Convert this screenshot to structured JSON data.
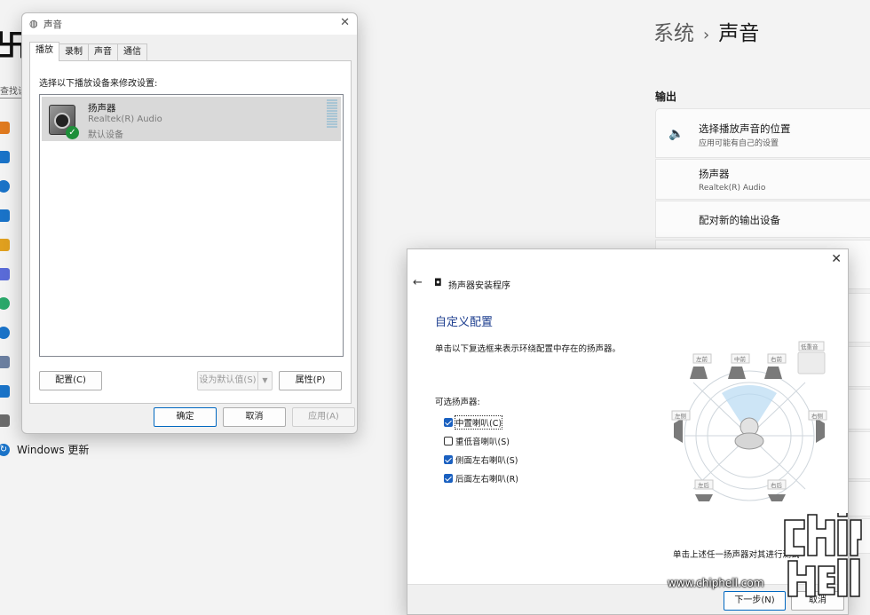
{
  "settings": {
    "search_text": "查找设",
    "breadcrumb_parent": "系统",
    "breadcrumb_sep": "›",
    "breadcrumb_current": "声音",
    "output_header": "输出",
    "rows": [
      {
        "icon": "speaker-icon",
        "title": "选择播放声音的位置",
        "sub": "应用可能有自己的设置"
      },
      {
        "title": "扬声器",
        "sub": "Realtek(R) Audio"
      },
      {
        "title": "配对新的输出设备"
      }
    ],
    "windows_update": "Windows 更新",
    "nav_colors": [
      "#e07a1f",
      "#1a73c8",
      "#1a73c8",
      "#1a73c8",
      "#e0a01f",
      "#5a6bd8",
      "#2aa86a",
      "#1a73c8",
      "#6b7fa0",
      "#1a73c8",
      "#6b6b6b"
    ]
  },
  "sound_dialog": {
    "title": "声音",
    "tabs": [
      "播放",
      "录制",
      "声音",
      "通信"
    ],
    "caption": "选择以下播放设备来修改设置:",
    "device": {
      "name": "扬声器",
      "driver": "Realtek(R) Audio",
      "status": "默认设备"
    },
    "configure_button": "配置(C)",
    "set_default_button": "设为默认值(S)",
    "properties_button": "属性(P)",
    "ok_button": "确定",
    "cancel_button": "取消",
    "apply_button": "应用(A)"
  },
  "wizard": {
    "title": "扬声器安装程序",
    "heading": "自定义配置",
    "description": "单击以下复选框来表示环绕配置中存在的扬声器。",
    "optional_label": "可选扬声器:",
    "options": [
      {
        "label": "中置喇叭(C)",
        "checked": true
      },
      {
        "label": "重低音喇叭(S)",
        "checked": false
      },
      {
        "label": "侧面左右喇叭(S)",
        "checked": true
      },
      {
        "label": "后面左右喇叭(R)",
        "checked": true
      }
    ],
    "speaker_labels": {
      "front_left": "左前",
      "center": "中前",
      "front_right": "右前",
      "subwoofer": "低重音",
      "side_left": "左侧",
      "side_right": "右侧",
      "rear_left": "左后",
      "rear_right": "右后"
    },
    "hint": "单击上述任一扬声器对其进行测试",
    "next_button": "下一步(N)",
    "cancel_button": "取消"
  },
  "watermark": {
    "url": "www.chiphell.com"
  }
}
